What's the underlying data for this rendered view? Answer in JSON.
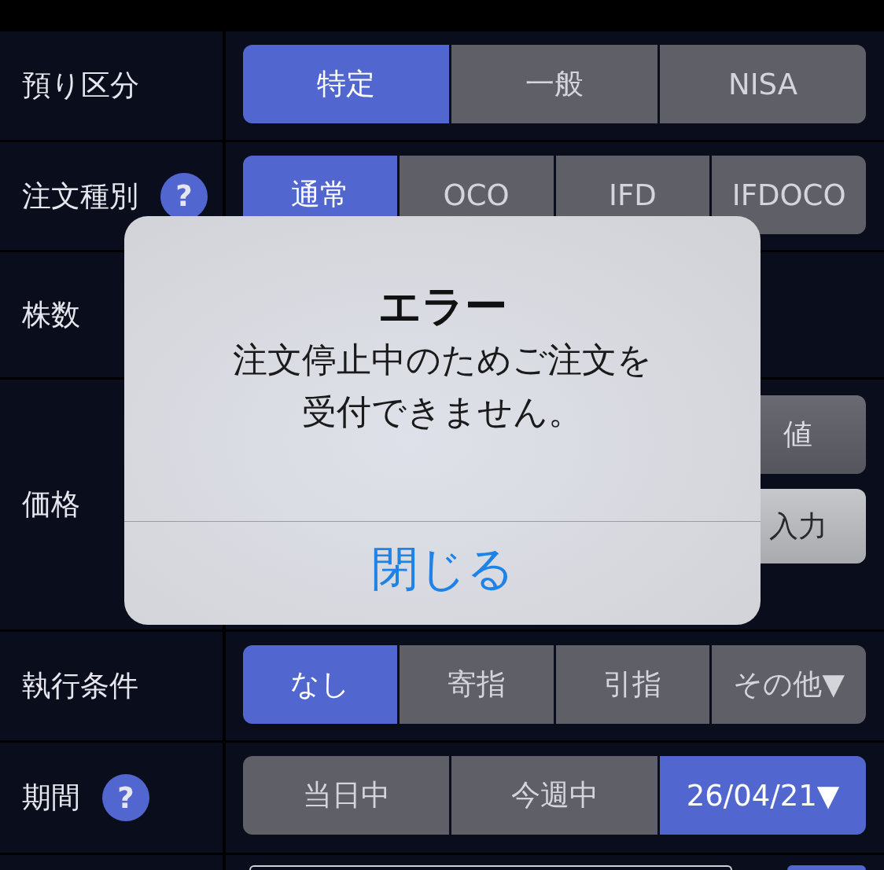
{
  "rows": [
    {
      "kind": "segmented",
      "label": "預り区分",
      "options": [
        {
          "label": "特定",
          "selected": true
        },
        {
          "label": "一般",
          "selected": false
        },
        {
          "label": "NISA",
          "selected": false
        }
      ]
    },
    {
      "kind": "segmented",
      "label": "注文種別",
      "help": "?",
      "options": [
        {
          "label": "通常",
          "selected": true
        },
        {
          "label": "OCO",
          "selected": false
        },
        {
          "label": "IFD",
          "selected": false
        },
        {
          "label": "IFDOCO",
          "selected": false
        }
      ]
    },
    {
      "kind": "empty",
      "label": "株数"
    },
    {
      "kind": "stacked",
      "label": "価格",
      "options": [
        {
          "label": "値"
        },
        {
          "label": "入力"
        }
      ]
    },
    {
      "kind": "segmented",
      "label": "執行条件",
      "options": [
        {
          "label": "なし",
          "selected": true
        },
        {
          "label": "寄指",
          "selected": false
        },
        {
          "label": "引指",
          "selected": false
        },
        {
          "label": "その他▼",
          "selected": false
        }
      ]
    },
    {
      "kind": "segmented",
      "label": "期間",
      "help": "?",
      "options": [
        {
          "label": "当日中",
          "selected": false
        },
        {
          "label": "今週中",
          "selected": false
        },
        {
          "label": "26/04/21▼",
          "selected": true
        }
      ]
    },
    {
      "kind": "input"
    }
  ],
  "dialog": {
    "title": "エラー",
    "message": [
      "注文停止中のためご注文を",
      "受付できません。"
    ],
    "button": "閉じる"
  }
}
